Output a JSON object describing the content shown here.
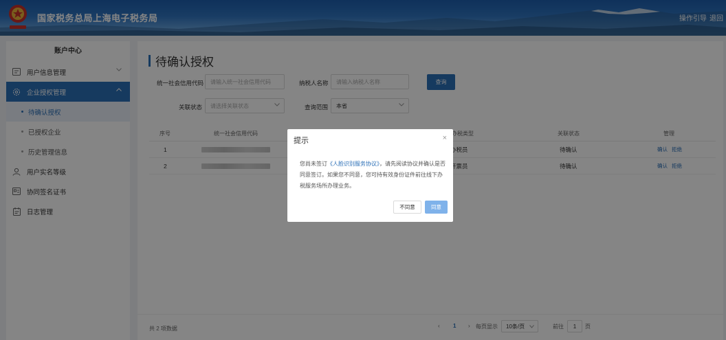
{
  "header": {
    "site_title": "国家税务总局上海电子税务局",
    "links": [
      "操作引导",
      "退回"
    ]
  },
  "sidebar": {
    "title": "账户中心",
    "items": [
      {
        "label": "用户信息管理",
        "icon": "user-card-icon"
      },
      {
        "label": "企业授权管理",
        "icon": "gear-icon"
      },
      {
        "label": "用户实名等级",
        "icon": "person-icon"
      },
      {
        "label": "协同签名证书",
        "icon": "certificate-icon"
      },
      {
        "label": "日志管理",
        "icon": "log-icon"
      }
    ],
    "submenu": [
      "待确认授权",
      "已授权企业",
      "历史管理信息"
    ]
  },
  "main": {
    "title": "待确认授权",
    "filters": {
      "credit_code_label": "统一社会信用代码",
      "credit_code_placeholder": "请输入统一社会信用代码",
      "taxpayer_label": "纳税人名称",
      "taxpayer_placeholder": "请输入纳税人名称",
      "query_button": "查询",
      "status_label": "关联状态",
      "status_placeholder": "请选择关联状态",
      "scope_label": "查询范围",
      "scope_value": "本省"
    },
    "table": {
      "headers": [
        "序号",
        "统一社会信用代码",
        "办税类型",
        "关联状态",
        "管理"
      ],
      "rows": [
        {
          "index": "1",
          "role": "办税员",
          "status": "待确认",
          "actions": [
            "确认",
            "拒绝"
          ]
        },
        {
          "index": "2",
          "role": "开票员",
          "status": "待确认",
          "actions": [
            "确认",
            "拒绝"
          ]
        }
      ]
    },
    "pagination": {
      "total_text": "共 2 项数据",
      "prev": "‹",
      "current_page": "1",
      "next": "›",
      "per_page_label": "每页显示",
      "per_page_value": "10条/页",
      "goto_label": "前往",
      "goto_value": "1",
      "page_suffix": "页"
    }
  },
  "modal": {
    "title": "提示",
    "close": "×",
    "body_before": "您尚未签订",
    "body_link": "《人脸识别服务协议》",
    "body_after": "，请先阅读协议并确认是否同意签订。如果您不同意，您可持有效身份证件前往线下办税服务场所办理业务。",
    "disagree_label": "不同意",
    "agree_label": "同意"
  },
  "colors": {
    "primary": "#2b6fb7",
    "agree_button": "#7fb2ea"
  }
}
